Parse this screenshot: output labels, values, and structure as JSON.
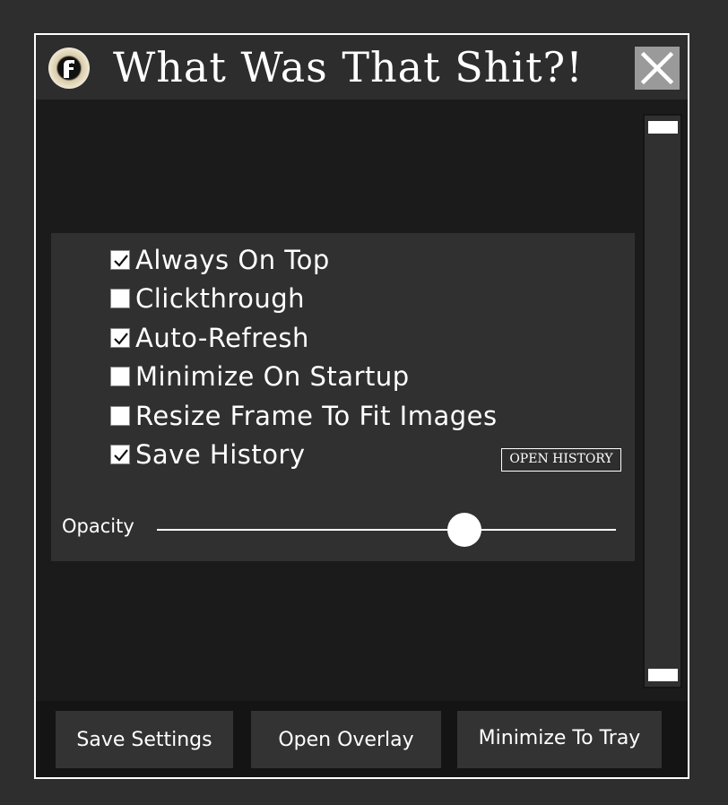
{
  "window": {
    "title": "What Was That Shit?!",
    "app_icon": "app-logo-icon",
    "close_icon": "close-icon"
  },
  "options": [
    {
      "label": "Always On Top",
      "checked": true
    },
    {
      "label": "Clickthrough",
      "checked": false
    },
    {
      "label": "Auto-Refresh",
      "checked": true
    },
    {
      "label": "Minimize On Startup",
      "checked": false
    },
    {
      "label": "Resize Frame To Fit Images",
      "checked": false
    },
    {
      "label": "Save History",
      "checked": true
    }
  ],
  "open_history_label": "OPEN HISTORY",
  "opacity": {
    "label": "Opacity",
    "value_fraction": 0.67
  },
  "footer": {
    "save_settings_label": "Save Settings",
    "open_overlay_label": "Open Overlay",
    "minimize_to_tray_label": "Minimize To Tray"
  },
  "colors": {
    "background": "#2e2e2e",
    "window": "#1b1b1b",
    "panel": "#303030",
    "button": "#333333",
    "close_button": "#9a9a9a",
    "text": "#ffffff"
  }
}
